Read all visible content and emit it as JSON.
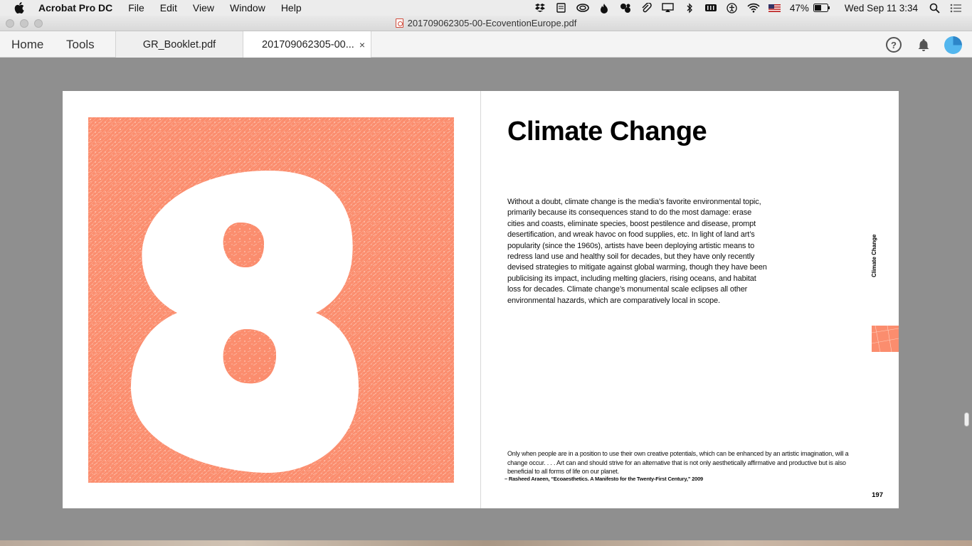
{
  "menubar": {
    "app_name": "Acrobat Pro DC",
    "menus": [
      "File",
      "Edit",
      "View",
      "Window",
      "Help"
    ],
    "battery_percent": "47%",
    "clock": "Wed Sep 11  3:34"
  },
  "window": {
    "title": "201709062305-00-EcoventionEurope.pdf"
  },
  "toolbar": {
    "home_label": "Home",
    "tools_label": "Tools",
    "tabs": [
      {
        "label": "GR_Booklet.pdf",
        "active": false
      },
      {
        "label": "201709062305-00...",
        "active": true
      }
    ],
    "close_glyph": "×",
    "help_glyph": "?"
  },
  "document": {
    "left_page": {
      "chapter_number": "8",
      "art_color": "#fb8d6e"
    },
    "right_page": {
      "title": "Climate Change",
      "body": "Without a doubt, climate change is the media’s favorite environmental topic, primarily because its consequences stand to do the most damage: erase cities and coasts, eliminate species, boost pestilence and disease, prompt desertification, and wreak havoc on food supplies, etc. In light of land art’s popularity (since the 1960s), artists have been deploying artistic means to redress land use and healthy soil for decades, but they have only recently devised strategies to mitigate against global warming, though they have been publicising its impact, including melting glaciers, rising oceans, and habitat loss for decades. Climate change’s monumental scale eclipses all other environmental hazards, which are comparatively local in scope.",
      "quote": "Only when people are in a position to use their own creative potentials, which can be enhanced by an artistic imagination, will a change occur. . . . Art can and should strive for an alternative that is not only aesthetically affirmative and productive but is also beneficial to all forms of life on our planet.",
      "quote_source": "– Rasheed Araeen, “Ecoaesthetics. A Manifesto for the Twenty-First Century,” 2009",
      "side_label": "Climate Change",
      "page_number": "197"
    }
  }
}
